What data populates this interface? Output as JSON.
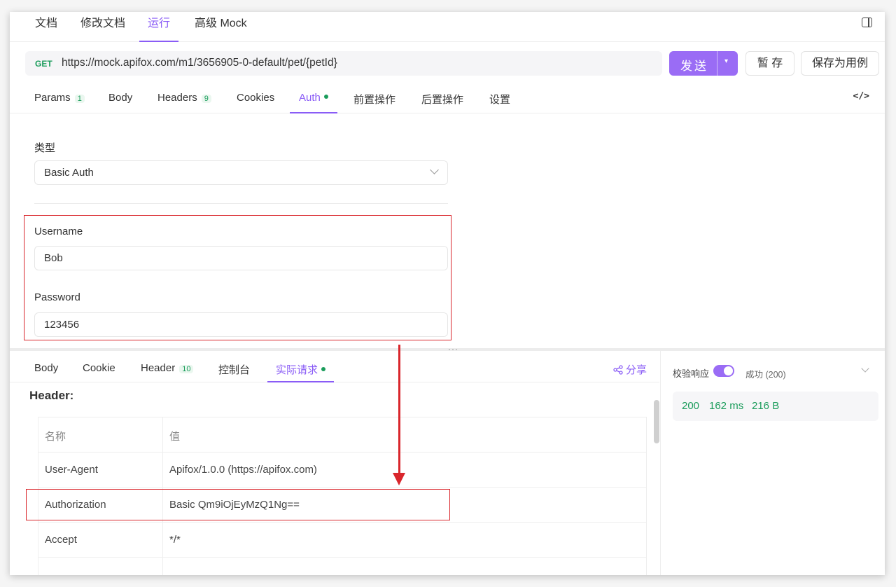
{
  "top_tabs": [
    {
      "label": "文档"
    },
    {
      "label": "修改文档"
    },
    {
      "label": "运行"
    },
    {
      "label": "高级 Mock"
    }
  ],
  "request": {
    "method": "GET",
    "url": "https://mock.apifox.com/m1/3656905-0-default/pet/{petId}",
    "send_label": "发送",
    "save_temp_label": "暂 存",
    "save_case_label": "保存为用例"
  },
  "request_tabs": [
    {
      "label": "Params",
      "count": "1"
    },
    {
      "label": "Body"
    },
    {
      "label": "Headers",
      "count": "9"
    },
    {
      "label": "Cookies"
    },
    {
      "label": "Auth"
    },
    {
      "label": "前置操作"
    },
    {
      "label": "后置操作"
    },
    {
      "label": "设置"
    }
  ],
  "code_icon_text": "</>",
  "auth": {
    "type_label": "类型",
    "type_value": "Basic Auth",
    "username_label": "Username",
    "username_value": "Bob",
    "password_label": "Password",
    "password_value": "123456"
  },
  "grip": "···",
  "response_tabs": [
    {
      "label": "Body"
    },
    {
      "label": "Cookie"
    },
    {
      "label": "Header",
      "count": "10"
    },
    {
      "label": "控制台"
    },
    {
      "label": "实际请求"
    }
  ],
  "share_label": "分享",
  "header_section": {
    "title": "Header:",
    "columns": [
      "名称",
      "值"
    ],
    "rows": [
      {
        "name": "User-Agent",
        "value": "Apifox/1.0.0 (https://apifox.com)"
      },
      {
        "name": "Authorization",
        "value": "Basic Qm9iOjEyMzQ1Ng=="
      },
      {
        "name": "Accept",
        "value": "*/*"
      }
    ]
  },
  "response_status": {
    "verify_label": "校验响应",
    "verify_enabled": true,
    "status_text": "成功 (200)",
    "code": "200",
    "time": "162 ms",
    "size": "216 B"
  },
  "colors": {
    "accent": "#8a5cf6",
    "success": "#1a9c5b",
    "highlight": "#d9262c"
  }
}
